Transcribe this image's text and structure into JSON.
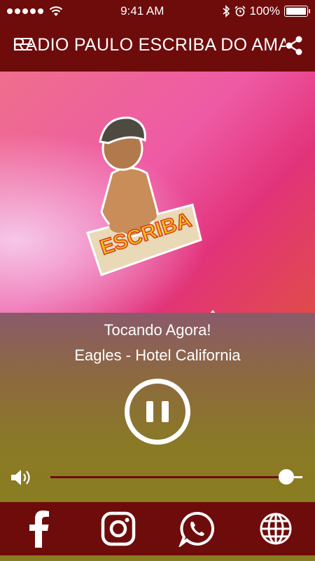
{
  "status_bar": {
    "time": "9:41 AM",
    "battery": "100%",
    "battery_level": 1.0
  },
  "header": {
    "title": "RADIO PAULO ESCRIBA DO AMARAL"
  },
  "artwork": {
    "logo_text": "ESCRIBA"
  },
  "player": {
    "now_playing_label": "Tocando Agora!",
    "song": "Eagles - Hotel California",
    "volume_level": 0.935
  },
  "social": [
    "facebook-icon",
    "instagram-icon",
    "whatsapp-icon",
    "globe-icon"
  ],
  "colors": {
    "header_bg": "#6e0c0c",
    "accent": "#6e0c0c",
    "player_bottom": "#8a7c20"
  }
}
